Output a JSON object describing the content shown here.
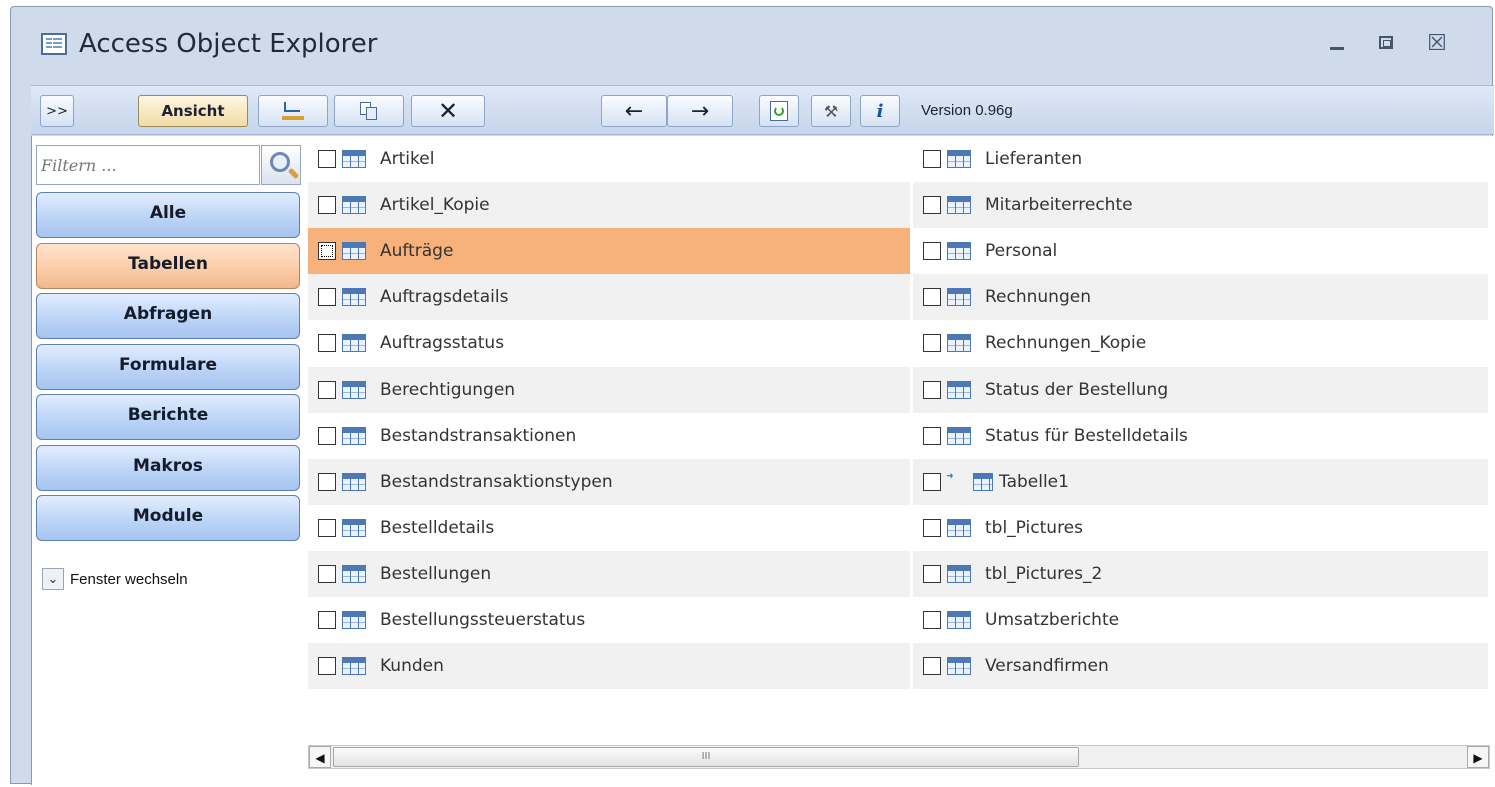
{
  "window": {
    "title": "Access Object Explorer",
    "buttons": {
      "minimize_icon": "minimize-icon",
      "maximize_icon": "restore-icon",
      "close_icon": "close-icon"
    }
  },
  "toolbar": {
    "expand_label": ">>",
    "view_label": "Ansicht",
    "edit_icon": "design-edit-icon",
    "copy_icon": "copy-icon",
    "delete_label": "✕",
    "back_label": "←",
    "forward_label": "→",
    "refresh_icon": "refresh-icon",
    "tools_icon": "tools-icon",
    "info_label": "i",
    "version": "Version 0.96g"
  },
  "sidebar": {
    "filter_placeholder": "Filtern ...",
    "nav": [
      {
        "label": "Alle",
        "active": false
      },
      {
        "label": "Tabellen",
        "active": true
      },
      {
        "label": "Abfragen",
        "active": false
      },
      {
        "label": "Formulare",
        "active": false
      },
      {
        "label": "Berichte",
        "active": false
      },
      {
        "label": "Makros",
        "active": false
      },
      {
        "label": "Module",
        "active": false
      }
    ],
    "switch_label": "Fenster wechseln"
  },
  "objects": {
    "left": [
      "Artikel",
      "Artikel_Kopie",
      "Aufträge",
      "Auftragsdetails",
      "Auftragsstatus",
      "Berechtigungen",
      "Bestandstransaktionen",
      "Bestandstransaktionstypen",
      "Bestelldetails",
      "Bestellungen",
      "Bestellungssteuerstatus",
      "Kunden"
    ],
    "right": [
      "Lieferanten",
      "Mitarbeiterrechte",
      "Personal",
      "Rechnungen",
      "Rechnungen_Kopie",
      "Status der Bestellung",
      "Status für Bestelldetails",
      "Tabelle1",
      "tbl_Pictures",
      "tbl_Pictures_2",
      "Umsatzberichte",
      "Versandfirmen"
    ],
    "selected": "Aufträge",
    "linked": "Tabelle1"
  },
  "scrollbar": {
    "thumb_label": "III"
  },
  "colors": {
    "selected_row": "#f7b27c",
    "active_nav": "#fbcba6",
    "nav": "#bcd4f6"
  }
}
